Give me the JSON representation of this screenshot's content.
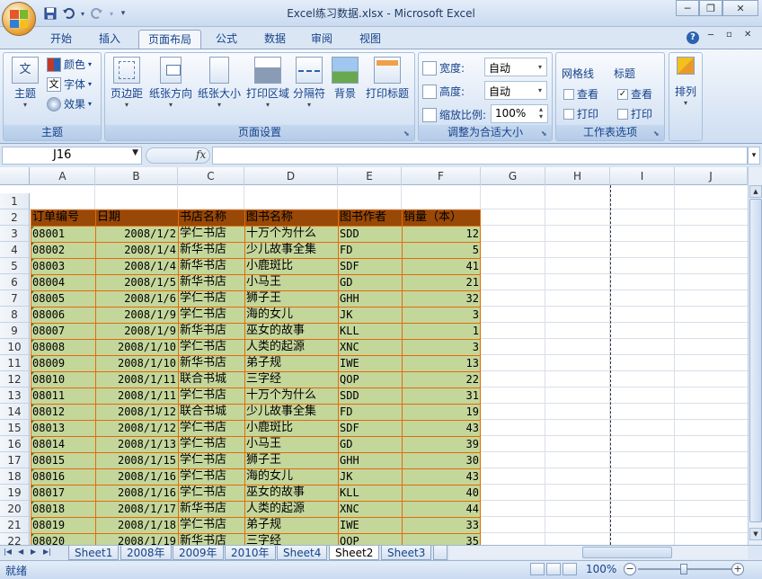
{
  "window": {
    "title": "Excel练习数据.xlsx - Microsoft Excel",
    "minimize": "─",
    "restore": "❐",
    "close": "✕"
  },
  "ribbon_tabs": [
    "开始",
    "插入",
    "页面布局",
    "公式",
    "数据",
    "审阅",
    "视图"
  ],
  "active_tab": "页面布局",
  "ribbon": {
    "theme_group": {
      "label": "主题",
      "theme_btn": "主题",
      "colors": "颜色",
      "fonts": "字体",
      "effects": "效果"
    },
    "page_setup_group": {
      "label": "页面设置",
      "margins": "页边距",
      "orientation": "纸张方向",
      "size": "纸张大小",
      "print_area": "打印区域",
      "breaks": "分隔符",
      "background": "背景",
      "print_titles": "打印标题"
    },
    "scale_group": {
      "label": "调整为合适大小",
      "width_label": "宽度:",
      "width_value": "自动",
      "height_label": "高度:",
      "height_value": "自动",
      "scale_label": "缩放比例:",
      "scale_value": "100%"
    },
    "sheet_options_group": {
      "label": "工作表选项",
      "gridlines": "网格线",
      "headings": "标题",
      "view": "查看",
      "print": "打印",
      "gridlines_view": false,
      "gridlines_print": false,
      "headings_view": true,
      "headings_print": false
    },
    "arrange_group": {
      "label": "排列"
    }
  },
  "formula_bar": {
    "name_box": "J16",
    "fx": "fx",
    "formula": ""
  },
  "columns": [
    "A",
    "B",
    "C",
    "D",
    "E",
    "F",
    "G",
    "H",
    "I",
    "J"
  ],
  "rows": [
    "1",
    "2",
    "3",
    "4",
    "5",
    "6",
    "7",
    "8",
    "9",
    "10",
    "11",
    "12",
    "13",
    "14",
    "15",
    "16",
    "17",
    "18",
    "19",
    "20",
    "21",
    "22"
  ],
  "table": {
    "headers": [
      "订单编号",
      "日期",
      "书店名称",
      "图书名称",
      "图书作者",
      "销量（本）"
    ],
    "rows": [
      [
        "08001",
        "2008/1/2",
        "学仁书店",
        "十万个为什么",
        "SDD",
        "12"
      ],
      [
        "08002",
        "2008/1/4",
        "新华书店",
        "少儿故事全集",
        "FD",
        "5"
      ],
      [
        "08003",
        "2008/1/4",
        "新华书店",
        "小鹿斑比",
        "SDF",
        "41"
      ],
      [
        "08004",
        "2008/1/5",
        "新华书店",
        "小马王",
        "GD",
        "21"
      ],
      [
        "08005",
        "2008/1/6",
        "学仁书店",
        "狮子王",
        "GHH",
        "32"
      ],
      [
        "08006",
        "2008/1/9",
        "学仁书店",
        "海的女儿",
        "JK",
        "3"
      ],
      [
        "08007",
        "2008/1/9",
        "新华书店",
        "巫女的故事",
        "KLL",
        "1"
      ],
      [
        "08008",
        "2008/1/10",
        "学仁书店",
        "人类的起源",
        "XNC",
        "3"
      ],
      [
        "08009",
        "2008/1/10",
        "新华书店",
        "弟子规",
        "IWE",
        "13"
      ],
      [
        "08010",
        "2008/1/11",
        "联合书城",
        "三字经",
        "QOP",
        "22"
      ],
      [
        "08011",
        "2008/1/11",
        "学仁书店",
        "十万个为什么",
        "SDD",
        "31"
      ],
      [
        "08012",
        "2008/1/12",
        "联合书城",
        "少儿故事全集",
        "FD",
        "19"
      ],
      [
        "08013",
        "2008/1/12",
        "学仁书店",
        "小鹿斑比",
        "SDF",
        "43"
      ],
      [
        "08014",
        "2008/1/13",
        "学仁书店",
        "小马王",
        "GD",
        "39"
      ],
      [
        "08015",
        "2008/1/15",
        "学仁书店",
        "狮子王",
        "GHH",
        "30"
      ],
      [
        "08016",
        "2008/1/16",
        "学仁书店",
        "海的女儿",
        "JK",
        "43"
      ],
      [
        "08017",
        "2008/1/16",
        "学仁书店",
        "巫女的故事",
        "KLL",
        "40"
      ],
      [
        "08018",
        "2008/1/17",
        "新华书店",
        "人类的起源",
        "XNC",
        "44"
      ],
      [
        "08019",
        "2008/1/18",
        "学仁书店",
        "弟子规",
        "IWE",
        "33"
      ],
      [
        "08020",
        "2008/1/19",
        "新华书店",
        "三字经",
        "QOP",
        "35"
      ]
    ]
  },
  "sheet_tabs": [
    "Sheet1",
    "2008年",
    "2009年",
    "2010年",
    "Sheet4",
    "Sheet2",
    "Sheet3"
  ],
  "active_sheet": "Sheet2",
  "status": {
    "text": "就绪",
    "zoom": "100%"
  },
  "colors": {
    "header_fill": "#984807",
    "body_fill": "#c4d79b",
    "border": "#e26b0a"
  }
}
